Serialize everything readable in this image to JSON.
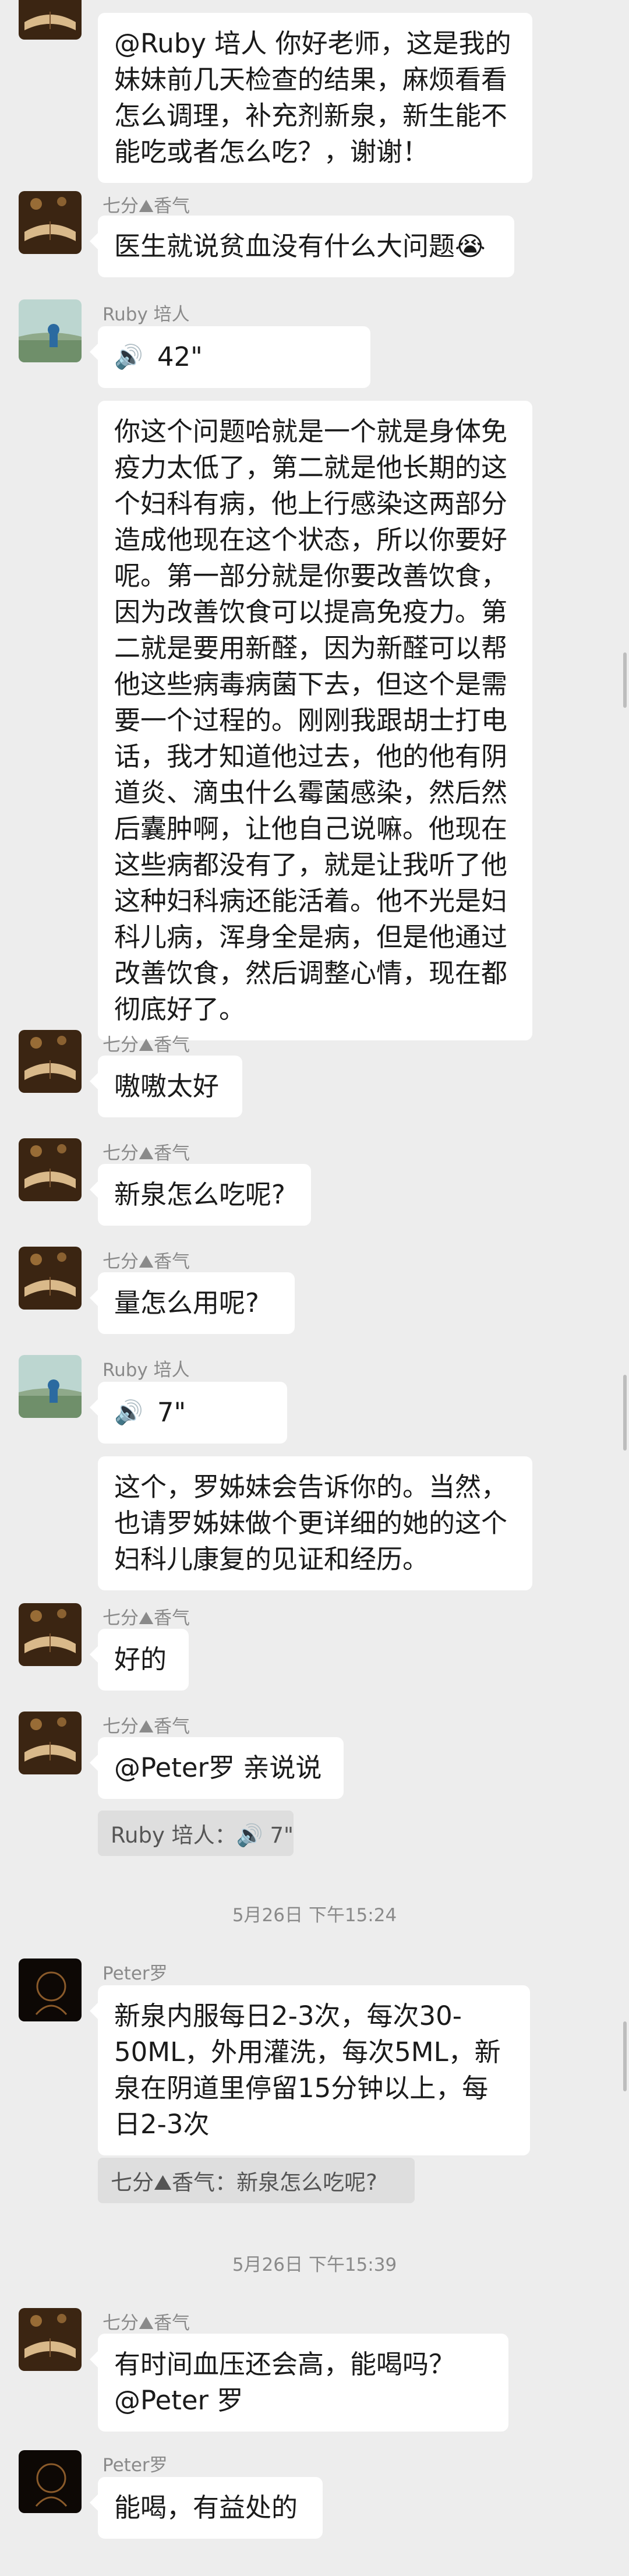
{
  "senders": {
    "qifen": "七分⛰香气",
    "ruby": "Ruby 培人",
    "peter": "Peter罗"
  },
  "messages": [
    {
      "text": "@Ruby 培人  你好老师，这是我的妹妹前几天检查的结果，麻烦看看怎么调理，补充剂新泉，新生能不能吃或者怎么吃？，谢谢！"
    },
    {
      "text": "医生就说贫血没有什么大问题😭"
    },
    {
      "voice_duration": "42\""
    },
    {
      "text": "你这个问题哈就是一个就是身体免疫力太低了，第二就是他长期的这个妇科有病，他上行感染这两部分造成他现在这个状态，所以你要好呢。第一部分就是你要改善饮食，因为改善饮食可以提高免疫力。第二就是要用新醛，因为新醛可以帮他这些病毒病菌下去，但这个是需要一个过程的。刚刚我跟胡士打电话，我才知道他过去，他的他有阴道炎、滴虫什么霉菌感染，然后然后囊肿啊，让他自己说嘛。他现在这些病都没有了，就是让我听了他这种妇科病还能活着。他不光是妇科儿病，浑身全是病，但是他通过改善饮食，然后调整心情，现在都彻底好了。"
    },
    {
      "text": "嗷嗷太好"
    },
    {
      "text": "新泉怎么吃呢?"
    },
    {
      "text": "量怎么用呢?"
    },
    {
      "voice_duration": "7\""
    },
    {
      "text": "这个，罗姊妹会告诉你的。当然，也请罗姊妹做个更详细的她的这个妇科儿康复的见证和经历。"
    },
    {
      "text": "好的"
    },
    {
      "text": "@Peter罗  亲说说",
      "quote": "Ruby 培人：🔊 7\""
    },
    {
      "text": "新泉内服每日2-3次，每次30-50ML，外用灌洗，每次5ML，新泉在阴道里停留15分钟以上，每日2-3次",
      "quote": "七分⛰香气：新泉怎么吃呢?"
    },
    {
      "text": "有时间血压还会高，能喝吗？@Peter 罗"
    },
    {
      "text": "能喝，有益处的"
    }
  ],
  "timestamps": [
    "5月26日 下午15:24",
    "5月26日 下午15:39"
  ],
  "colors": {
    "background": "#ededed",
    "bubble": "#ffffff",
    "meta_text": "#8a8a8a"
  }
}
